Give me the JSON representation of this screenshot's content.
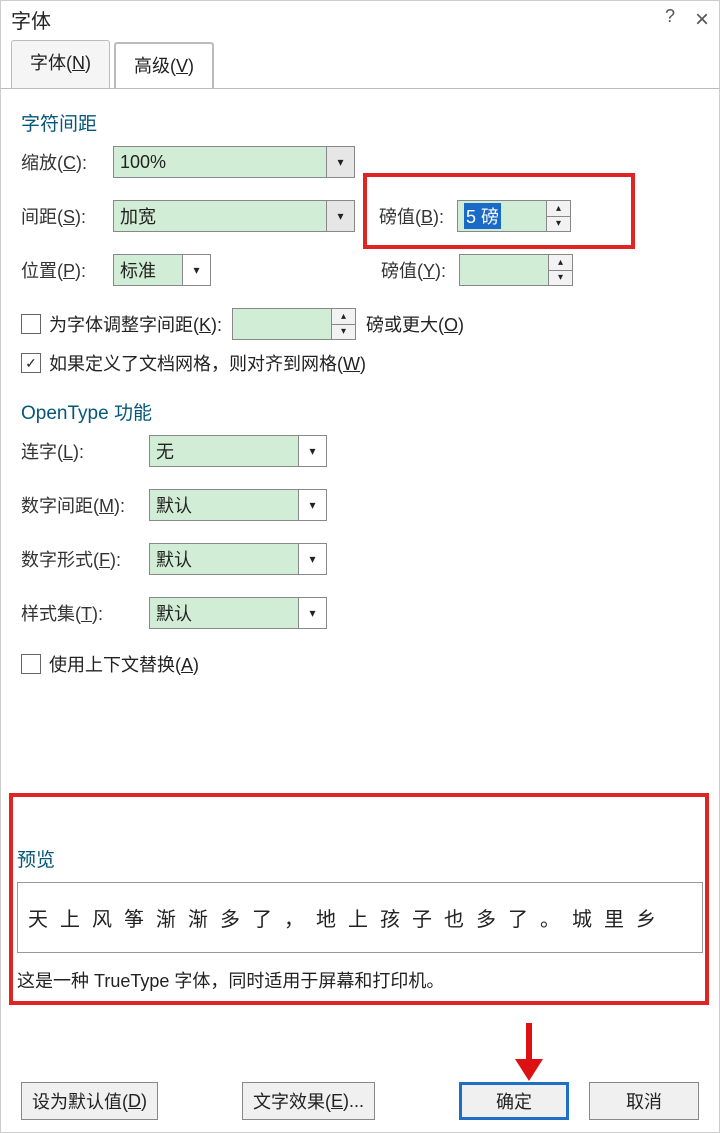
{
  "window": {
    "title": "字体",
    "help": "?"
  },
  "tabs": {
    "font": "字体(N)",
    "adv": "高级(V)"
  },
  "spacing_section": {
    "title": "字符间距",
    "scale_label": "缩放(C):",
    "scale_value": "100%",
    "spacing_label": "间距(S):",
    "spacing_value": "加宽",
    "bangzhi_label": "磅值(B):",
    "bangzhi_value": "5 磅",
    "pos_label": "位置(P):",
    "pos_value": "标准",
    "bangzhi2_label": "磅值(Y):",
    "bangzhi2_value": "",
    "kerning_chk": "为字体调整字间距(K):",
    "kerning_val": "",
    "kerning_unit": "磅或更大(O)",
    "grid_chk": "如果定义了文档网格，则对齐到网格(W)"
  },
  "opentype_section": {
    "title": "OpenType 功能",
    "ligature_label": "连字(L):",
    "ligature_value": "无",
    "numsp_label": "数字间距(M):",
    "numsp_value": "默认",
    "numform_label": "数字形式(F):",
    "numform_value": "默认",
    "style_label": "样式集(T):",
    "style_value": "默认",
    "context_chk": "使用上下文替换(A)"
  },
  "preview": {
    "title": "预览",
    "text": "天上风筝渐渐多了，地上孩子也多了。城里乡",
    "note": "这是一种 TrueType 字体，同时适用于屏幕和打印机。"
  },
  "buttons": {
    "default": "设为默认值(D)",
    "effects": "文字效果(E)...",
    "ok": "确定",
    "cancel": "取消"
  }
}
